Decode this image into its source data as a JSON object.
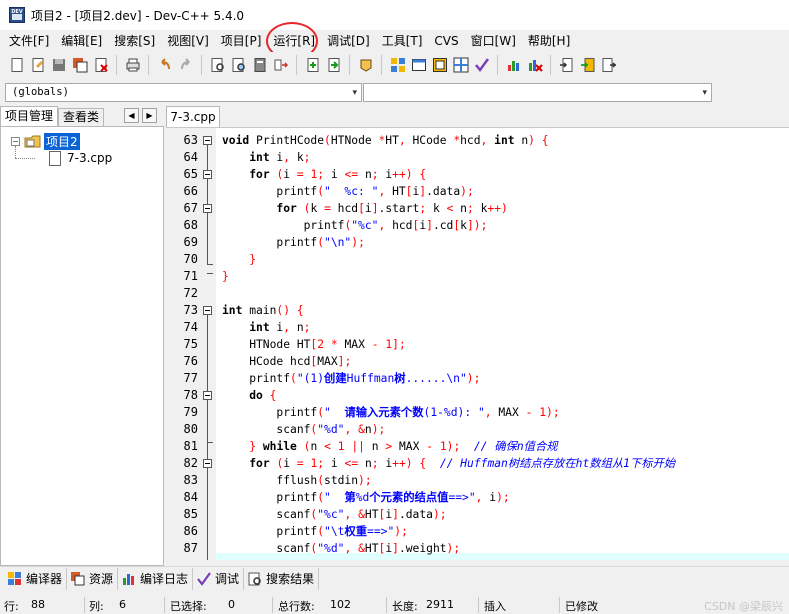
{
  "window": {
    "title": "项目2 - [项目2.dev] - Dev-C++ 5.4.0"
  },
  "menu": [
    "文件[F]",
    "编辑[E]",
    "搜索[S]",
    "视图[V]",
    "项目[P]",
    "运行[R]",
    "调试[D]",
    "工具[T]",
    "CVS",
    "窗口[W]",
    "帮助[H]"
  ],
  "combo": {
    "scope": "(globals)",
    "function": ""
  },
  "left_panel": {
    "tabs": [
      "项目管理",
      "查看类"
    ],
    "project": "项目2",
    "file": "7-3.cpp"
  },
  "editor": {
    "tab": "7-3.cpp",
    "lines": [
      {
        "n": 63,
        "t": "void PrintHCode(HTNode *HT, HCode *hcd, int n) {"
      },
      {
        "n": 64,
        "t": "    int i, k;"
      },
      {
        "n": 65,
        "t": "    for (i = 1; i <= n; i++) {"
      },
      {
        "n": 66,
        "t": "        printf(\"  %c: \", HT[i].data);"
      },
      {
        "n": 67,
        "t": "        for (k = hcd[i].start; k < n; k++)"
      },
      {
        "n": 68,
        "t": "            printf(\"%c\", hcd[i].cd[k]);"
      },
      {
        "n": 69,
        "t": "        printf(\"\\n\");"
      },
      {
        "n": 70,
        "t": "    }"
      },
      {
        "n": 71,
        "t": "}"
      },
      {
        "n": 72,
        "t": ""
      },
      {
        "n": 73,
        "t": "int main() {"
      },
      {
        "n": 74,
        "t": "    int i, n;"
      },
      {
        "n": 75,
        "t": "    HTNode HT[2 * MAX - 1];"
      },
      {
        "n": 76,
        "t": "    HCode hcd[MAX];"
      },
      {
        "n": 77,
        "t": "    printf(\"(1)创建Huffman树......\\n\");"
      },
      {
        "n": 78,
        "t": "    do {"
      },
      {
        "n": 79,
        "t": "        printf(\"  请输入元素个数(1-%d): \", MAX - 1);"
      },
      {
        "n": 80,
        "t": "        scanf(\"%d\", &n);"
      },
      {
        "n": 81,
        "t": "    } while (n < 1 || n > MAX - 1);  // 确保n值合规"
      },
      {
        "n": 82,
        "t": "    for (i = 1; i <= n; i++) {  // Huffman树结点存放在ht数组从1下标开始"
      },
      {
        "n": 83,
        "t": "        fflush(stdin);"
      },
      {
        "n": 84,
        "t": "        printf(\"  第%d个元素的结点值==>\", i);"
      },
      {
        "n": 85,
        "t": "        scanf(\"%c\", &HT[i].data);"
      },
      {
        "n": 86,
        "t": "        printf(\"\\t权重==>\");"
      },
      {
        "n": 87,
        "t": "        scanf(\"%d\", &HT[i].weight);"
      }
    ]
  },
  "bottom_tabs": [
    "编译器",
    "资源",
    "编译日志",
    "调试",
    "搜索结果"
  ],
  "status": {
    "row_label": "行:",
    "row": "88",
    "col_label": "列:",
    "col": "6",
    "sel_label": "已选择:",
    "sel": "0",
    "total_label": "总行数:",
    "total": "102",
    "len_label": "长度:",
    "len": "2911",
    "mode": "插入",
    "modified": "已修改"
  },
  "watermark": "CSDN @梁辰兴",
  "colors": {
    "selection": "#0a64d8",
    "current_line": "#e0ffff",
    "string": "#0000ff",
    "number": "#ff0000",
    "highlight_circle": "#e8262b"
  }
}
